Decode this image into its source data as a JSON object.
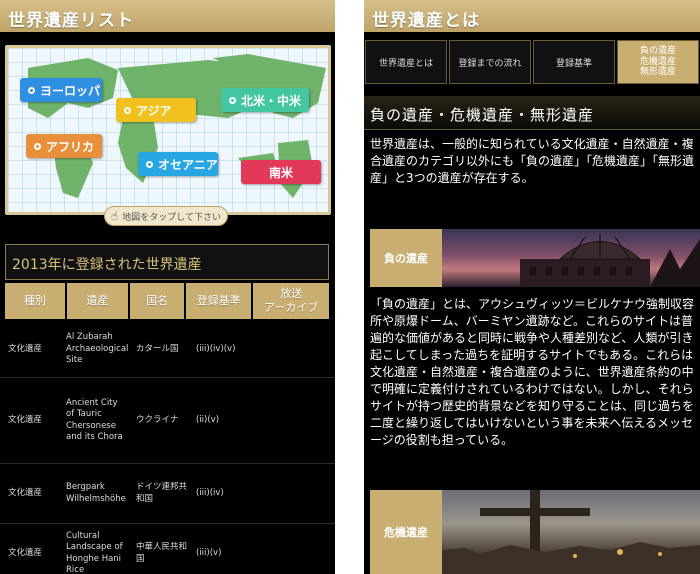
{
  "left": {
    "title": "世界遺産リスト",
    "regions": [
      {
        "label": "ヨーロッパ",
        "color": "#2f8fe0"
      },
      {
        "label": "アジア",
        "color": "#f1c21f"
      },
      {
        "label": "北米・中米",
        "color": "#43c6a1"
      },
      {
        "label": "アフリカ",
        "color": "#e88f3c"
      },
      {
        "label": "オセアニア",
        "color": "#27a7e1"
      },
      {
        "label": "南米",
        "color": "#e2395b"
      }
    ],
    "map_hint": "地図をタップして下さい",
    "year_header": "2013年に登録された世界遺産",
    "columns": [
      "種別",
      "遺産",
      "国名",
      "登録基準",
      "放送\nアーカイブ"
    ],
    "rows": [
      {
        "type": "文化遺産",
        "name": "Al Zubarah Archaeological Site",
        "country": "カタール国",
        "criteria": "(iii)(iv)(v)"
      },
      {
        "type": "文化遺産",
        "name": "Ancient City of Tauric Chersonese and its Chora",
        "country": "ウクライナ",
        "criteria": "(ii)(v)"
      },
      {
        "type": "文化遺産",
        "name": "Bergpark Wilhelmshöhe",
        "country": "ドイツ連邦共和国",
        "criteria": "(iii)(iv)"
      },
      {
        "type": "文化遺産",
        "name": "Cultural Landscape of Honghe Hani Rice",
        "country": "中華人民共和国",
        "criteria": "(iii)(v)"
      }
    ]
  },
  "right": {
    "title": "世界遺産とは",
    "tabs": [
      "世界遺産とは",
      "登録までの流れ",
      "登録基準",
      "負の遺産\n危機遺産\n無形遺産"
    ],
    "section_title": "負の遺産・危機遺産・無形遺産",
    "para1": "世界遺産は、一般的に知られている文化遺産・自然遺産・複合遺産のカテゴリ以外にも「負の遺産」「危機遺産」「無形遺産」と3つの遺産が存在する。",
    "banner1_label": "負の遺産",
    "para2": "「負の遺産」とは、アウシュヴィッツ＝ビルケナウ強制収容所や原爆ドーム、バーミヤン遺跡など。これらのサイトは普遍的な価値があると同時に戦争や人種差別など、人類が引き起こしてしまった過ちを証明するサイトでもある。これらは文化遺産・自然遺産・複合遺産のように、世界遺産条約の中で明確に定義付けされているわけではない。しかし、それらサイトが持つ歴史的背景などを知り守ることは、同じ過ちを二度と繰り返してはいけないという事を未来へ伝えるメッセージの役割も担っている。",
    "banner2_label": "危機遺産"
  }
}
